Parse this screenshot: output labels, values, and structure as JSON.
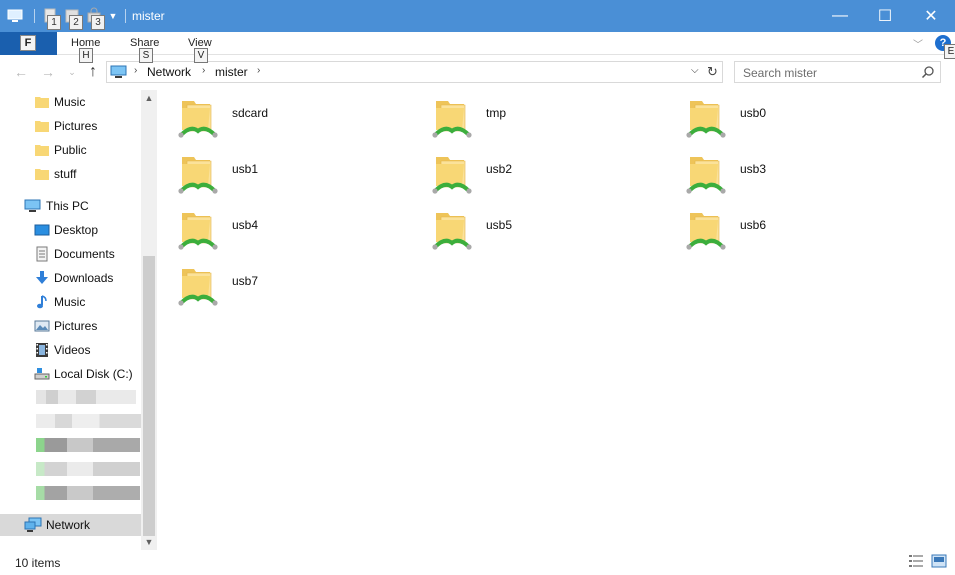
{
  "window": {
    "title": "mister",
    "quick_access_keys": [
      "1",
      "2",
      "3"
    ],
    "controls": {
      "minimize": "—",
      "maximize": "☐",
      "close": "✕"
    }
  },
  "ribbon": {
    "file_key": "F",
    "tabs": [
      {
        "label": "Home",
        "key": "H"
      },
      {
        "label": "Share",
        "key": "S"
      },
      {
        "label": "View",
        "key": "V"
      }
    ],
    "help_key": "E",
    "help_glyph": "?"
  },
  "address": {
    "crumbs": [
      "Network",
      "mister"
    ],
    "search_placeholder": "Search mister"
  },
  "nav": {
    "quick_items": [
      {
        "label": "Music",
        "icon": "folder-icon"
      },
      {
        "label": "Pictures",
        "icon": "folder-icon"
      },
      {
        "label": "Public",
        "icon": "folder-icon"
      },
      {
        "label": "stuff",
        "icon": "folder-icon"
      }
    ],
    "this_pc": "This PC",
    "pc_items": [
      {
        "label": "Desktop",
        "icon": "desktop-icon"
      },
      {
        "label": "Documents",
        "icon": "documents-icon"
      },
      {
        "label": "Downloads",
        "icon": "downloads-icon"
      },
      {
        "label": "Music",
        "icon": "music-icon"
      },
      {
        "label": "Pictures",
        "icon": "pictures-icon"
      },
      {
        "label": "Videos",
        "icon": "videos-icon"
      },
      {
        "label": "Local Disk (C:)",
        "icon": "local-disk-icon"
      }
    ],
    "network": "Network"
  },
  "folders": [
    "sdcard",
    "tmp",
    "usb0",
    "usb1",
    "usb2",
    "usb3",
    "usb4",
    "usb5",
    "usb6",
    "usb7"
  ],
  "status": {
    "item_count": "10 items"
  },
  "colors": {
    "titlebar": "#4a8fd6",
    "file_tab": "#1a5fae",
    "folder": "#f8d775",
    "share_green": "#3cae3c"
  }
}
